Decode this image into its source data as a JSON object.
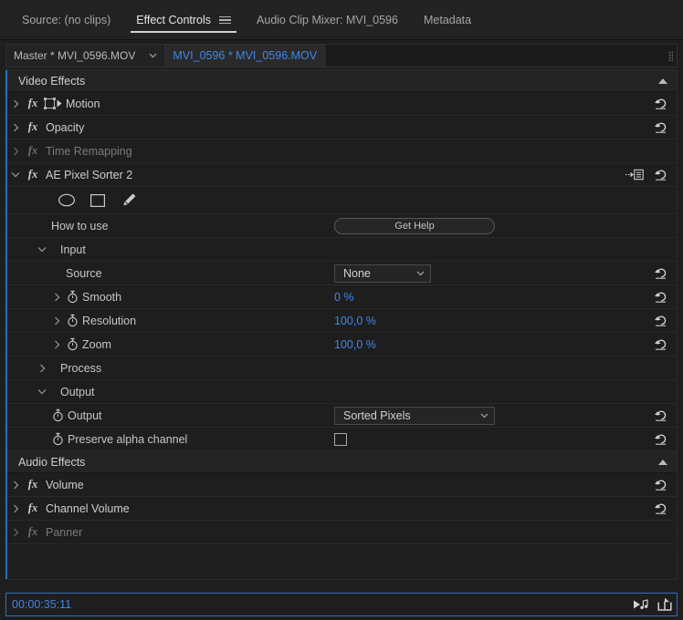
{
  "panel_tabs": [
    {
      "label": "Source: (no clips)",
      "active": false,
      "has_menu": false
    },
    {
      "label": "Effect Controls",
      "active": true,
      "has_menu": true
    },
    {
      "label": "Audio Clip Mixer: MVI_0596",
      "active": false,
      "has_menu": false
    },
    {
      "label": "Metadata",
      "active": false,
      "has_menu": false
    }
  ],
  "master_bar": {
    "master_label": "Master * MVI_0596.MOV",
    "clip_label": "MVI_0596 * MVI_0596.MOV"
  },
  "video_effects": {
    "header": "Video Effects",
    "items": [
      {
        "name": "Motion",
        "enabled": true,
        "expanded": false,
        "has_reset": true,
        "icon": "motion-transform-icon"
      },
      {
        "name": "Opacity",
        "enabled": true,
        "expanded": false,
        "has_reset": true,
        "icon": null
      },
      {
        "name": "Time Remapping",
        "enabled": false,
        "expanded": false,
        "has_reset": false,
        "icon": null
      },
      {
        "name": "AE Pixel Sorter 2",
        "enabled": true,
        "expanded": true,
        "has_reset": true,
        "icon": null
      }
    ]
  },
  "mask_tools": [
    {
      "name": "ellipse-mask-tool"
    },
    {
      "name": "rectangle-mask-tool"
    },
    {
      "name": "pen-mask-tool"
    }
  ],
  "effect_params": {
    "how_to_use_label": "How to use",
    "get_help_label": "Get Help",
    "input_section": "Input",
    "source_label": "Source",
    "source_value": "None",
    "smooth_label": "Smooth",
    "smooth_value": "0 %",
    "resolution_label": "Resolution",
    "resolution_value": "100,0 %",
    "zoom_label": "Zoom",
    "zoom_value": "100,0 %",
    "process_section": "Process",
    "output_section": "Output",
    "output_label": "Output",
    "output_value": "Sorted Pixels",
    "preserve_alpha_label": "Preserve alpha channel",
    "preserve_alpha_checked": false
  },
  "audio_effects": {
    "header": "Audio Effects",
    "items": [
      {
        "name": "Volume",
        "enabled": true,
        "has_reset": true
      },
      {
        "name": "Channel Volume",
        "enabled": true,
        "has_reset": true
      },
      {
        "name": "Panner",
        "enabled": false,
        "has_reset": false
      }
    ]
  },
  "footer": {
    "timecode": "00:00:35:11",
    "icons": [
      {
        "name": "play-audio-icon"
      },
      {
        "name": "export-frame-icon"
      }
    ]
  },
  "colors": {
    "accent_blue": "#3f87e8",
    "focus_border": "#2d6fbe",
    "panel_bg": "#1e1e1e",
    "header_bg": "#242424",
    "text": "#c8c8c8",
    "text_dim": "#7a7a7a"
  }
}
